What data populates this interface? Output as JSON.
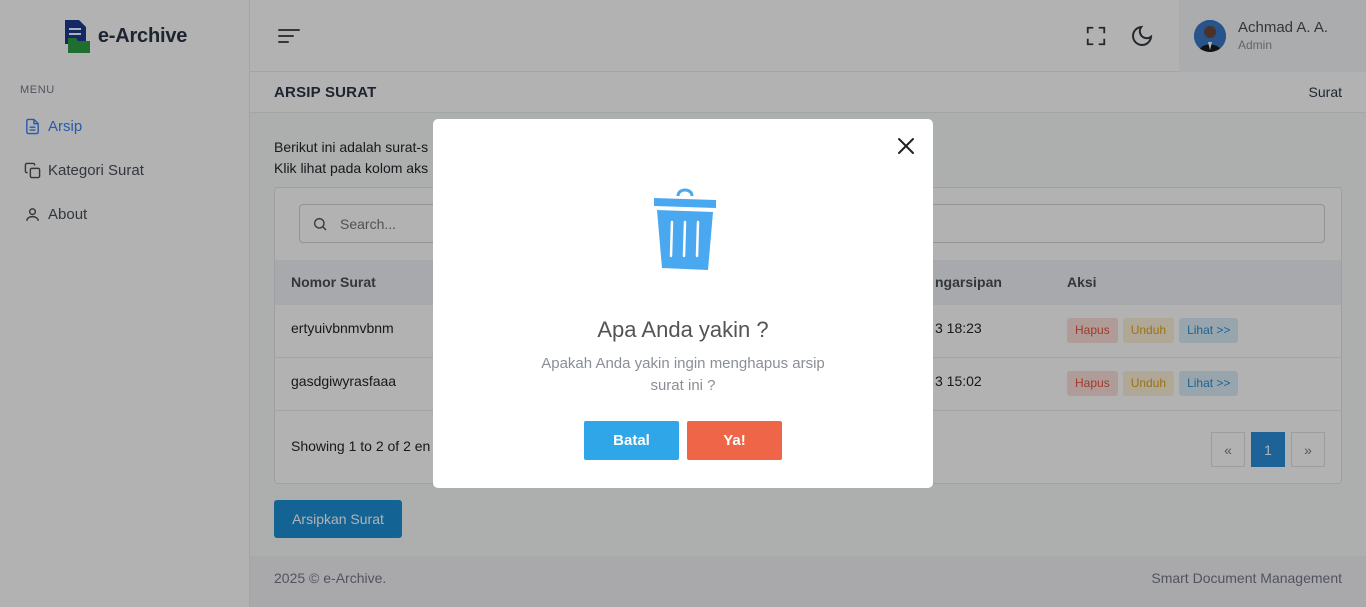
{
  "brand": {
    "name": "e-Archive"
  },
  "sidebar": {
    "menu_title": "MENU",
    "items": [
      {
        "label": "Arsip",
        "icon": "file-text-icon",
        "active": true
      },
      {
        "label": "Kategori Surat",
        "icon": "copy-icon",
        "active": false
      },
      {
        "label": "About",
        "icon": "user-icon",
        "active": false
      }
    ]
  },
  "header": {
    "user": {
      "name": "Achmad A. A.",
      "role": "Admin"
    }
  },
  "page": {
    "title": "ARSIP SURAT",
    "breadcrumb": "Surat",
    "intro_line1": "Berikut ini adalah surat-s",
    "intro_line2": "Klik lihat pada kolom aks"
  },
  "table": {
    "search_placeholder": "Search...",
    "columns": [
      "Nomor Surat",
      "ngarsipan",
      "Aksi"
    ],
    "rows": [
      {
        "nomor": "ertyuivbnmvbnm",
        "waktu": "3 18:23"
      },
      {
        "nomor": "gasdgiwyrasfaaa",
        "waktu": "3 15:02"
      }
    ],
    "actions": {
      "hapus": "Hapus",
      "unduh": "Unduh",
      "lihat": "Lihat >>"
    },
    "showing": "Showing 1 to 2 of 2 en",
    "pagination": {
      "prev": "«",
      "current": "1",
      "next": "»"
    }
  },
  "archive_button": "Arsipkan Surat",
  "footer": {
    "left": "2025 © e-Archive.",
    "right": "Smart Document Management"
  },
  "modal": {
    "title": "Apa Anda yakin ?",
    "text": "Apakah Anda yakin ingin menghapus arsip surat ini ?",
    "cancel": "Batal",
    "confirm": "Ya!",
    "accent": "#4aa8f0"
  }
}
